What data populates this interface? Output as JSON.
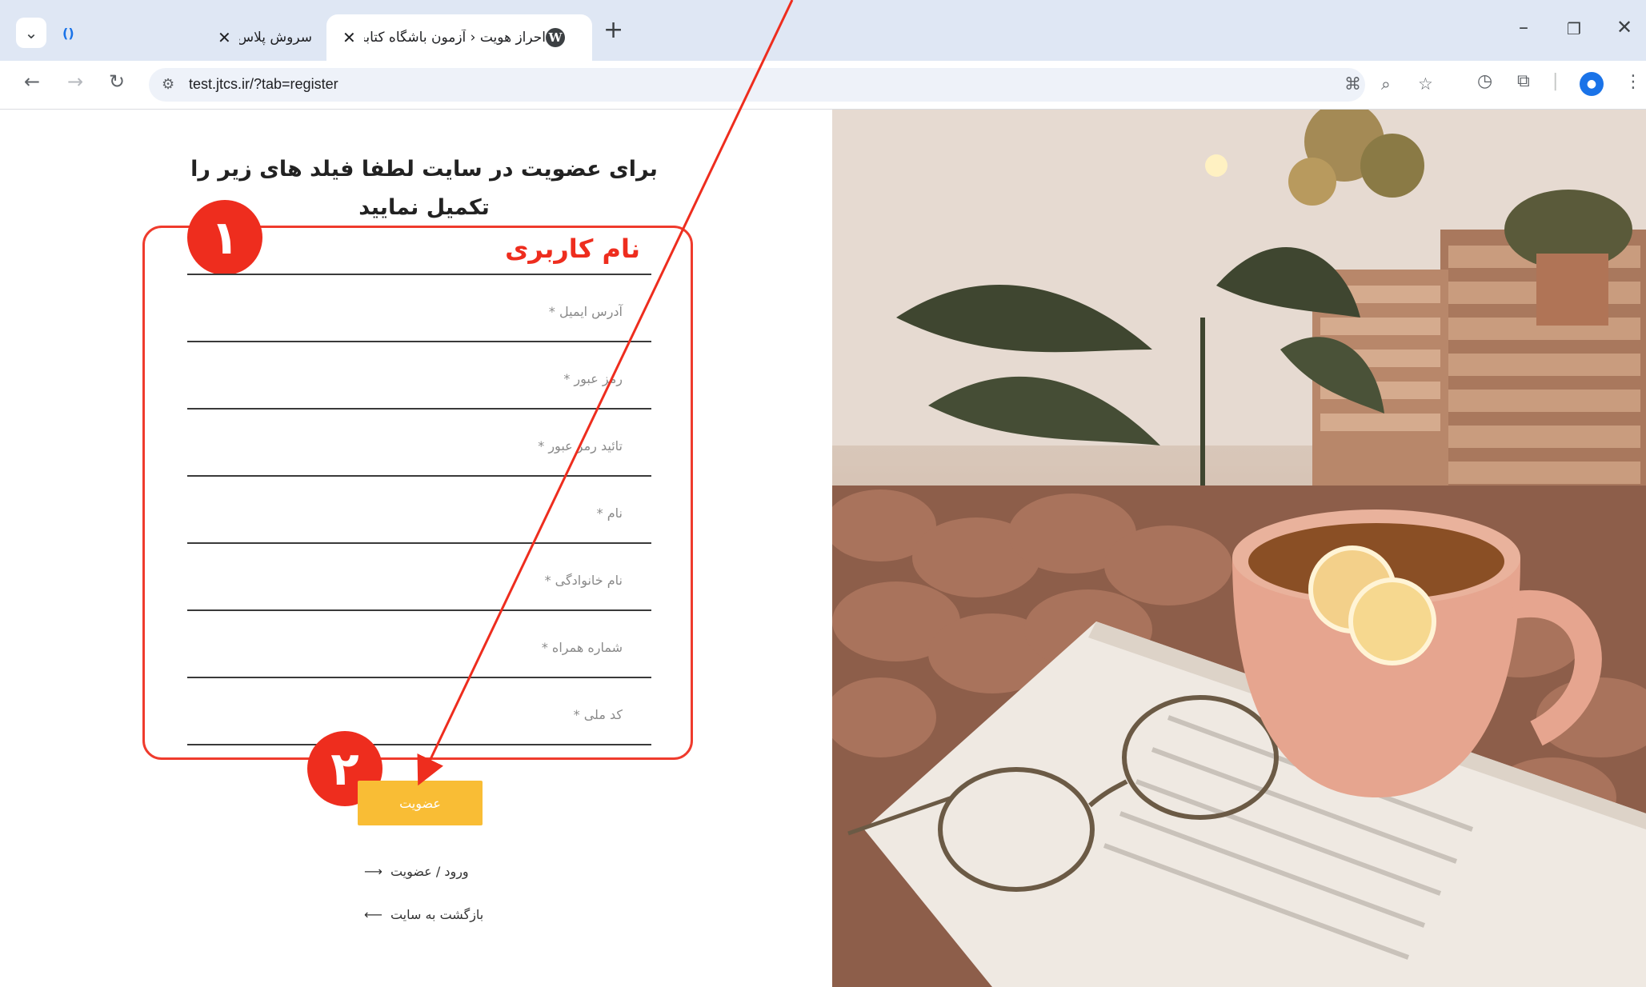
{
  "browser": {
    "tabs": [
      {
        "title": "سروش پلاس",
        "active": false
      },
      {
        "title": "احراز هویت ‹ آزمون باشگاه کتابخوانی ...",
        "active": true
      }
    ],
    "address": "test.jtcs.ir/?tab=register"
  },
  "form": {
    "heading": "برای عضویت در سایت لطفا فیلد های زیر را تکمیل نمایید",
    "highlight_label": "نام کاربری",
    "fields": [
      {
        "label": ""
      },
      {
        "label": "آدرس ایمیل *"
      },
      {
        "label": "رمز عبور *"
      },
      {
        "label": "تائید رمز عبور *"
      },
      {
        "label": "نام *"
      },
      {
        "label": "نام خانوادگی *"
      },
      {
        "label": "شماره همراه *"
      },
      {
        "label": "کد ملی *"
      }
    ],
    "submit_label": "عضویت",
    "login_link": "ورود / عضویت",
    "back_link": "بازگشت به سایت"
  },
  "annotations": {
    "badge_1": "۱",
    "badge_2": "۲",
    "color": "#ee2d1e"
  },
  "colors": {
    "submit": "#f9bd35"
  }
}
